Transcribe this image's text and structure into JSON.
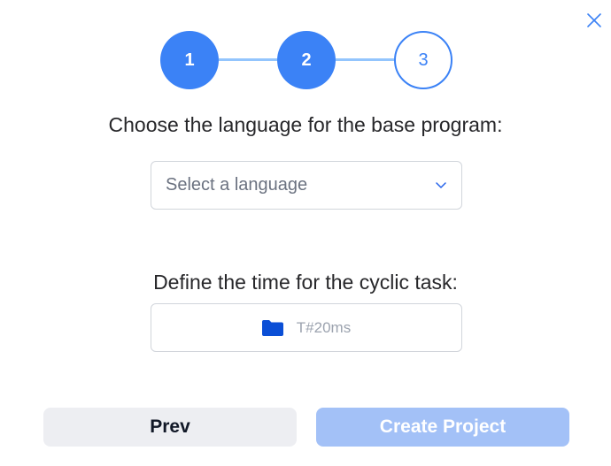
{
  "stepper": {
    "steps": [
      {
        "label": "1",
        "state": "completed"
      },
      {
        "label": "2",
        "state": "completed"
      },
      {
        "label": "3",
        "state": "current"
      }
    ]
  },
  "language_section": {
    "title": "Choose the language for the base program:",
    "select_placeholder": "Select a language"
  },
  "cycle_section": {
    "title": "Define the time for the cyclic task:",
    "value": "T#20ms"
  },
  "footer": {
    "prev_label": "Prev",
    "create_label": "Create Project"
  },
  "colors": {
    "accent": "#3b82f6",
    "accent_light": "#93c5fd",
    "disabled_button": "#a3c1f7",
    "secondary_button": "#edeef2",
    "folder_icon": "#0b4fd6"
  },
  "icons": {
    "close": "close-icon",
    "dropdown": "chevron-down-icon",
    "time_field": "folder-icon"
  }
}
